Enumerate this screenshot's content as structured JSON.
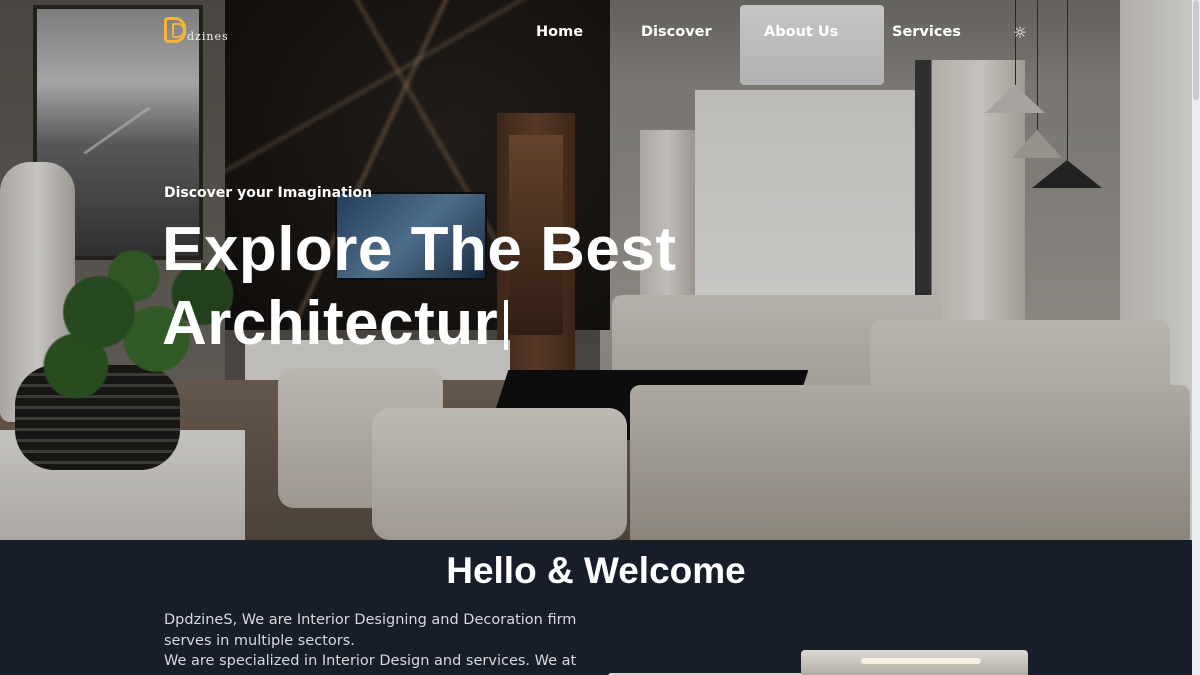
{
  "brand": {
    "logo_text": "dzines",
    "logo_color": "#f2b53b"
  },
  "nav": {
    "items": [
      {
        "label": "Home"
      },
      {
        "label": "Discover"
      },
      {
        "label": "About Us"
      },
      {
        "label": "Services"
      }
    ],
    "theme_toggle_icon": "sun-icon",
    "theme_toggle_glyph": "☼"
  },
  "hero": {
    "tagline": "Discover your Imagination",
    "headline_line1": "Explore The Best",
    "headline_line2": "Architectur"
  },
  "welcome": {
    "title": "Hello & Welcome",
    "paragraph1": "DpdzineS, We are Interior Designing and Decoration firm serves in multiple sectors.",
    "paragraph2": "We are specialized in Interior Design and services. We at"
  },
  "colors": {
    "welcome_background": "#171e29",
    "text_primary": "#ffffff",
    "text_body": "#d6d9de"
  }
}
